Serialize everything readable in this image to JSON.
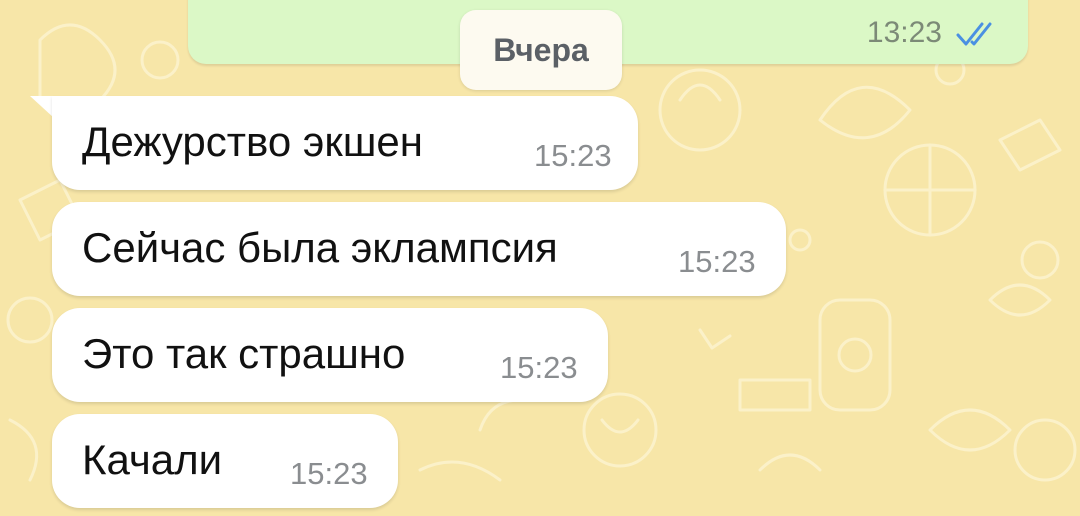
{
  "date_divider": "Вчера",
  "outgoing": {
    "time": "13:23",
    "status_icon": "double-check-read-icon",
    "status_color": "#4a90e2"
  },
  "messages": [
    {
      "text": "Дежурство экшен",
      "time": "15:23"
    },
    {
      "text": "Сейчас была эклампсия",
      "time": "15:23"
    },
    {
      "text": "Это так страшно",
      "time": "15:23"
    },
    {
      "text": "Качали",
      "time": "15:23"
    }
  ],
  "colors": {
    "wallpaper": "#f7e6a8",
    "incoming_bubble": "#ffffff",
    "outgoing_bubble": "#dbf8c6",
    "date_pill": "#fdfaf0"
  }
}
